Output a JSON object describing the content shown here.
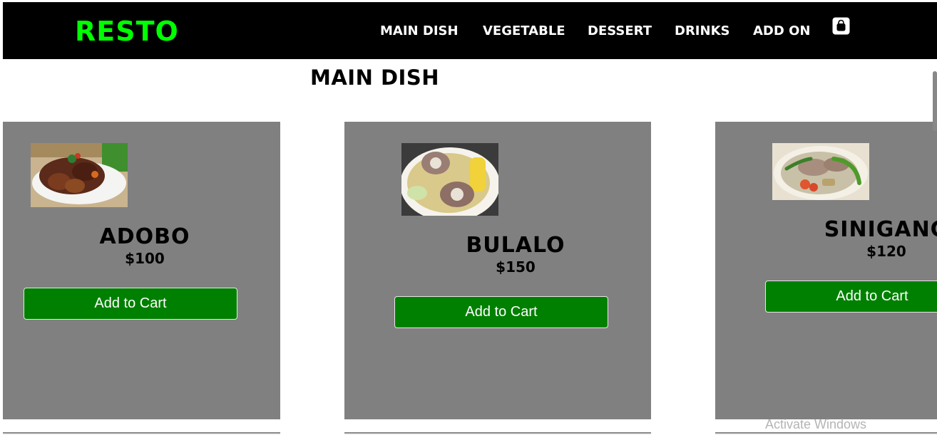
{
  "header": {
    "brand": "RESTO",
    "nav": [
      "MAIN DISH",
      "VEGETABLE",
      "DESSERT",
      "DRINKS",
      "ADD ON"
    ],
    "cart_icon": "shopping-bag-icon"
  },
  "section": {
    "title": "MAIN DISH"
  },
  "products": [
    {
      "name": "ADOBO",
      "price": "$100",
      "button": "Add to Cart",
      "image": "adobo-dish-photo"
    },
    {
      "name": "BULALO",
      "price": "$150",
      "button": "Add to Cart",
      "image": "bulalo-soup-photo"
    },
    {
      "name": "SINIGANG",
      "price": "$120",
      "button": "Add to Cart",
      "image": "sinigang-soup-photo"
    }
  ],
  "os": {
    "watermark": "Activate Windows"
  },
  "colors": {
    "navbar": "#000000",
    "brand": "#00ff00",
    "card": "#808080",
    "button": "#008000",
    "page": "#ffffff"
  }
}
